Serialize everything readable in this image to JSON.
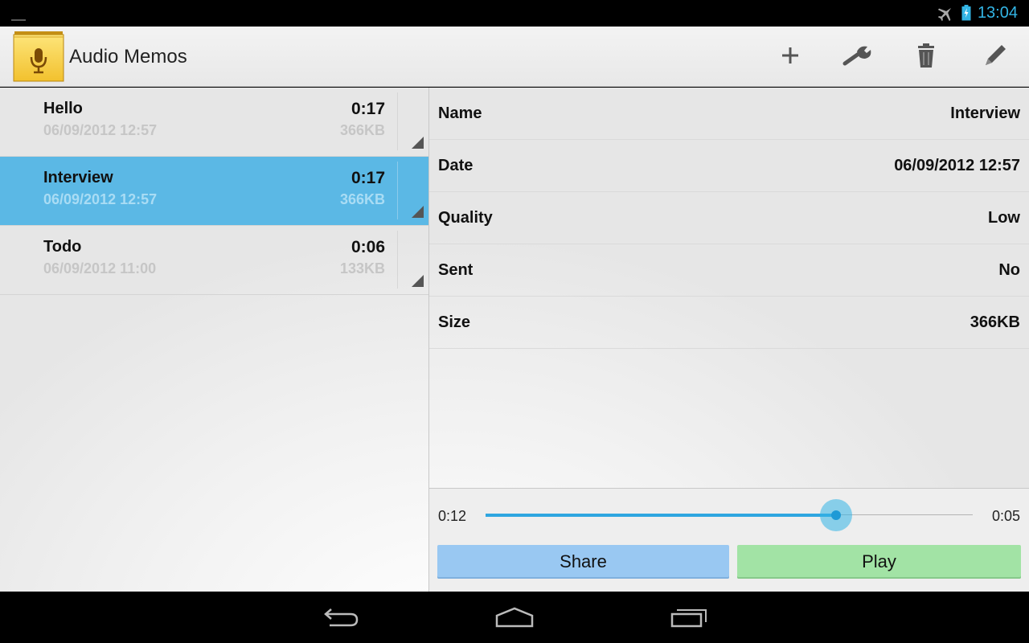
{
  "status_bar": {
    "time": "13:04",
    "icons": [
      "notification-icon",
      "airplane-mode-icon",
      "battery-charging-icon"
    ]
  },
  "action_bar": {
    "title": "Audio Memos",
    "app_icon": "microphone-notepad-icon",
    "actions": [
      "add-icon",
      "wrench-icon",
      "trash-icon",
      "pencil-icon"
    ]
  },
  "memos": [
    {
      "name": "Hello",
      "date": "06/09/2012 12:57",
      "duration": "0:17",
      "size": "366KB",
      "selected": false
    },
    {
      "name": "Interview",
      "date": "06/09/2012 12:57",
      "duration": "0:17",
      "size": "366KB",
      "selected": true
    },
    {
      "name": "Todo",
      "date": "06/09/2012 11:00",
      "duration": "0:06",
      "size": "133KB",
      "selected": false
    }
  ],
  "details": {
    "rows": [
      {
        "label": "Name",
        "value": "Interview"
      },
      {
        "label": "Date",
        "value": "06/09/2012 12:57"
      },
      {
        "label": "Quality",
        "value": "Low"
      },
      {
        "label": "Sent",
        "value": "No"
      },
      {
        "label": "Size",
        "value": "366KB"
      }
    ]
  },
  "player": {
    "elapsed": "0:12",
    "remaining": "0:05",
    "progress": 0.72,
    "share_label": "Share",
    "play_label": "Play"
  },
  "colors": {
    "accent": "#33b5e5",
    "selected_row": "#5bb8e5",
    "share_button": "#99c8f2",
    "play_button": "#a2e3a5",
    "app_icon": "#f2c12e"
  },
  "nav_bar": {
    "icons": [
      "back-icon",
      "home-icon",
      "recent-apps-icon"
    ]
  }
}
